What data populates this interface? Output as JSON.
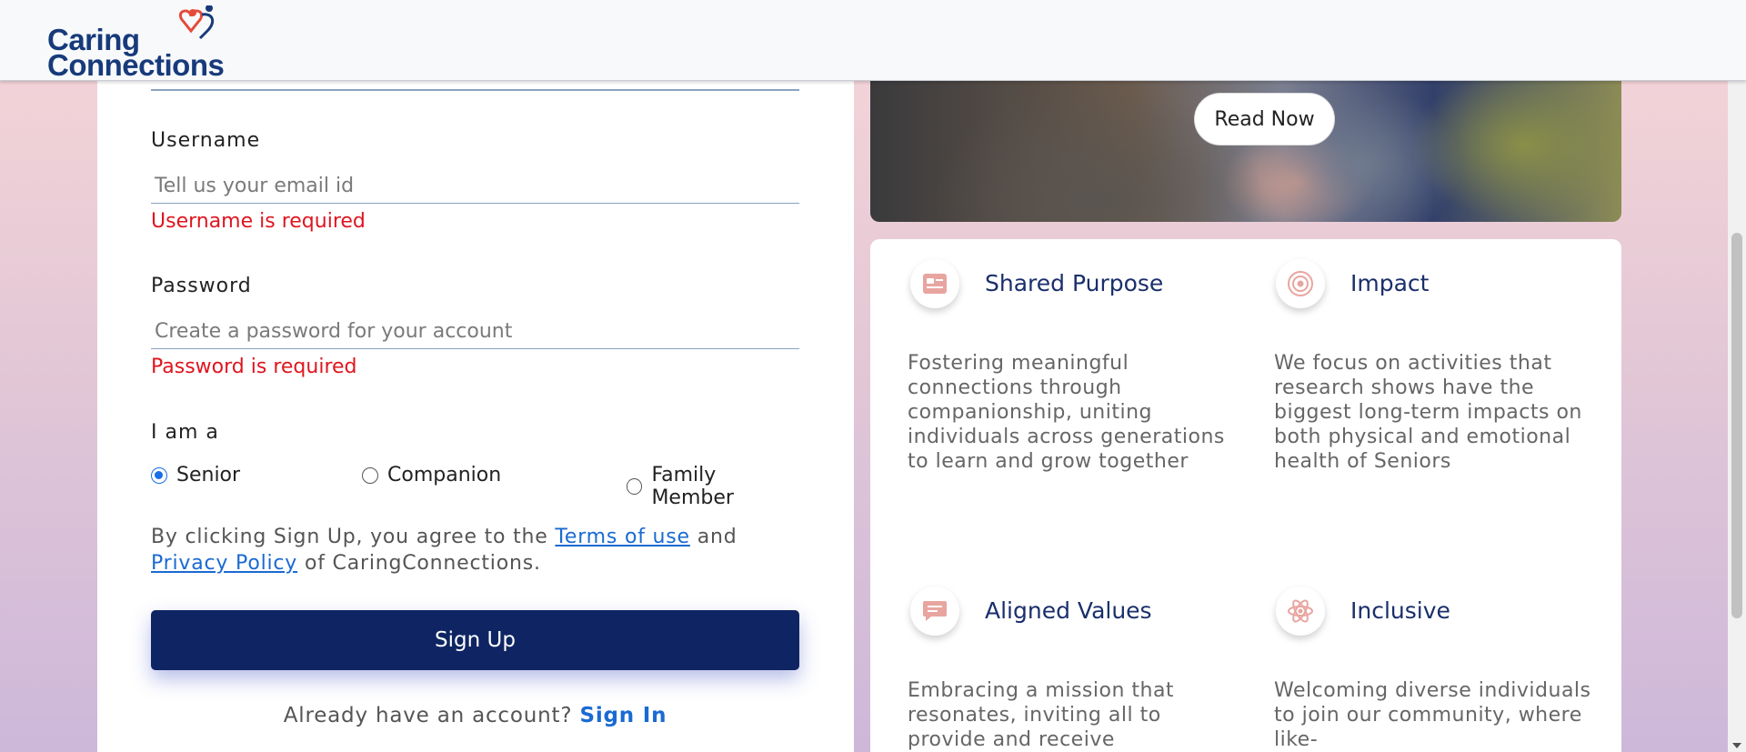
{
  "header": {
    "logo": {
      "line1": "Caring",
      "line2": "Connections"
    }
  },
  "form": {
    "username": {
      "label": "Username",
      "placeholder": "Tell us your email id",
      "error": "Username is required"
    },
    "password": {
      "label": "Password",
      "placeholder": "Create a password for your account",
      "error": "Password is required"
    },
    "role": {
      "label": "I am a",
      "options": [
        "Senior",
        "Companion",
        "Family Member"
      ],
      "selected": "Senior"
    },
    "terms": {
      "prefix": "By clicking Sign Up, you agree to the",
      "terms_link": "Terms of use",
      "middle": "and",
      "privacy_link": "Privacy Policy",
      "suffix": "of CaringConnections."
    },
    "signup_label": "Sign Up",
    "signin_prompt": "Already have an account?",
    "signin_link": "Sign In"
  },
  "image_card": {
    "button_label": "Read Now"
  },
  "features": [
    {
      "title": "Shared Purpose",
      "icon": "id-card-icon",
      "description": "Fostering meaningful connections through companionship, uniting individuals across generations to learn and grow together"
    },
    {
      "title": "Impact",
      "icon": "target-icon",
      "description": "We focus on activities that research shows have the biggest long-term impacts on both physical and emotional health of Seniors"
    },
    {
      "title": "Aligned Values",
      "icon": "chat-icon",
      "description": "Embracing a mission that resonates, inviting all to provide and receive"
    },
    {
      "title": "Inclusive",
      "icon": "atom-icon",
      "description": "Welcoming diverse individuals to join our community, where like-"
    }
  ],
  "colors": {
    "primary": "#0f2563",
    "link": "#1a6ad2",
    "error": "#e0151f",
    "icon_accent": "#e8a5a0",
    "feature_title": "#1a2f6b"
  }
}
